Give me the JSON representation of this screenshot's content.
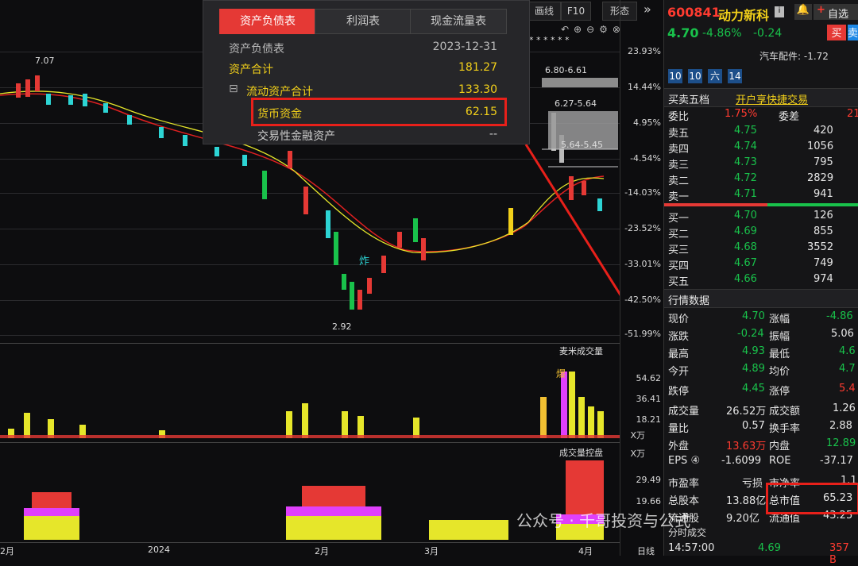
{
  "toolbar": {
    "draw": "画线",
    "f10": "F10",
    "shape": "形态",
    "collapse": "»"
  },
  "finance": {
    "tabs": [
      "资产负债表",
      "利润表",
      "现金流量表"
    ],
    "header_label": "资产负债表",
    "header_date": "2023-12-31",
    "rows": [
      {
        "label": "资产合计",
        "value": "181.27"
      },
      {
        "label": "流动资产合计",
        "value": "133.30"
      },
      {
        "label": "货币资金",
        "value": "62.15"
      },
      {
        "label": "交易性金融资产",
        "value": "--"
      }
    ],
    "expand_icon": "⊟"
  },
  "chart": {
    "pct_labels": [
      "23.93%",
      "14.44%",
      "4.95%",
      "-4.54%",
      "-14.03%",
      "-23.52%",
      "-33.01%",
      "-42.50%",
      "-51.99%"
    ],
    "high_label": "7.07",
    "low_label": "2.92",
    "bomb_label": "炸",
    "resist_labels": [
      "6.80-6.61",
      "6.27-5.64",
      "5.64-5.45"
    ],
    "month_labels": [
      "2月",
      "2024",
      "2月",
      "3月",
      "4月"
    ],
    "period_label": "日线",
    "vol_title": "麦米成交量",
    "vol_ticks": [
      "54.62",
      "36.41",
      "18.21"
    ],
    "vol_unit": "X万",
    "ctrl_title": "成交量控盘",
    "ctrl_unit": "X万",
    "ctrl_ticks": [
      "29.49",
      "19.66"
    ],
    "bao_label": "爆",
    "stars": "* * * * * *"
  },
  "stock": {
    "code": "600841",
    "name": "动力新科",
    "flag": "i",
    "watch_label": "自选",
    "price": "4.70",
    "change_pct": "-4.86%",
    "change": "-0.24",
    "buy_label": "买",
    "sell_label": "卖",
    "sector": "汽车配件: -1.72",
    "speed_btns": [
      "10",
      "10",
      "六",
      "14"
    ],
    "five_label": "买卖五档",
    "fast_trade": "开户享快捷交易",
    "ratio_label": "委比",
    "ratio_value": "1.75%",
    "diff_label": "委差",
    "diff_value": "21",
    "asks": [
      {
        "label": "卖五",
        "price": "4.75",
        "vol": "420"
      },
      {
        "label": "卖四",
        "price": "4.74",
        "vol": "1056"
      },
      {
        "label": "卖三",
        "price": "4.73",
        "vol": "795"
      },
      {
        "label": "卖二",
        "price": "4.72",
        "vol": "2829"
      },
      {
        "label": "卖一",
        "price": "4.71",
        "vol": "941"
      }
    ],
    "bids": [
      {
        "label": "买一",
        "price": "4.70",
        "vol": "126"
      },
      {
        "label": "买二",
        "price": "4.69",
        "vol": "855"
      },
      {
        "label": "买三",
        "price": "4.68",
        "vol": "3552"
      },
      {
        "label": "买四",
        "price": "4.67",
        "vol": "749"
      },
      {
        "label": "买五",
        "price": "4.66",
        "vol": "974"
      }
    ],
    "quote_title": "行情数据",
    "quotes": [
      {
        "l1": "现价",
        "v1": "4.70",
        "c1": "g",
        "l2": "涨幅",
        "v2": "-4.86",
        "c2": "g"
      },
      {
        "l1": "涨跌",
        "v1": "-0.24",
        "c1": "g",
        "l2": "振幅",
        "v2": "5.06",
        "c2": "w"
      },
      {
        "l1": "最高",
        "v1": "4.93",
        "c1": "g",
        "l2": "最低",
        "v2": "4.6",
        "c2": "g"
      },
      {
        "l1": "今开",
        "v1": "4.89",
        "c1": "g",
        "l2": "均价",
        "v2": "4.7",
        "c2": "g"
      },
      {
        "l1": "跌停",
        "v1": "4.45",
        "c1": "g",
        "l2": "涨停",
        "v2": "5.4",
        "c2": "r"
      },
      {
        "l1": "成交量",
        "v1": "26.52万",
        "c1": "w",
        "l2": "成交额",
        "v2": "1.26",
        "c2": "w"
      },
      {
        "l1": "量比",
        "v1": "0.57",
        "c1": "w",
        "l2": "换手率",
        "v2": "2.88",
        "c2": "w"
      },
      {
        "l1": "外盘",
        "v1": "13.63万",
        "c1": "r",
        "l2": "内盘",
        "v2": "12.89",
        "c2": "g"
      },
      {
        "l1": "EPS ④",
        "v1": "-1.6099",
        "c1": "w",
        "l2": "ROE",
        "v2": "-37.17",
        "c2": "w"
      },
      {
        "l1": "市盈率",
        "v1": "亏损",
        "c1": "w",
        "l2": "市净率",
        "v2": "1.1",
        "c2": "w"
      },
      {
        "l1": "总股本",
        "v1": "13.88亿",
        "c1": "w",
        "l2": "总市值",
        "v2": "65.23",
        "c2": "w"
      },
      {
        "l1": "流通股",
        "v1": "9.20亿",
        "c1": "w",
        "l2": "流通值",
        "v2": "43.25",
        "c2": "w"
      }
    ],
    "ticks_title": "分时成交",
    "last_tick": {
      "time": "14:57:00",
      "price": "4.69",
      "vol": "357 B"
    }
  },
  "watermark": "公众号 · 千哥投资与公式"
}
